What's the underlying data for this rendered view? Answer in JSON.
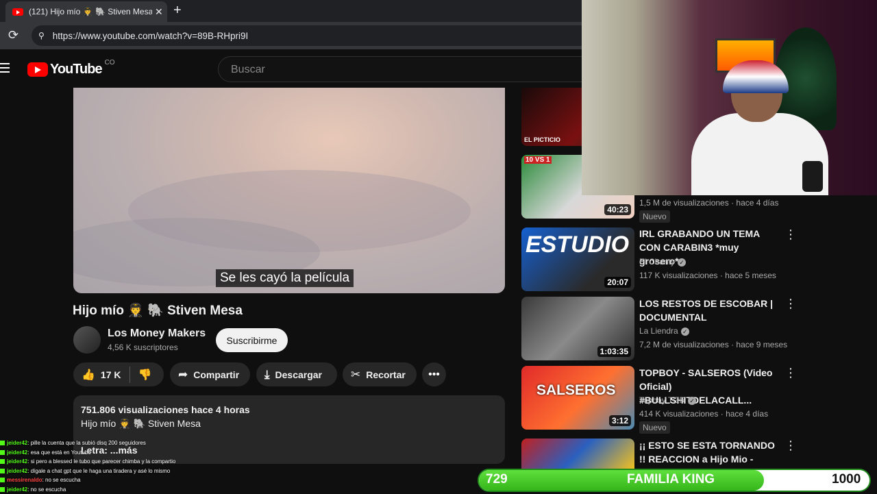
{
  "browser": {
    "tab_title": "(121) Hijo mío 🧑‍✈️ 🐘 Stiven Mesa",
    "tab_close": "✕",
    "new_tab": "+",
    "url": "https://www.youtube.com/watch?v=89B-RHpri9I"
  },
  "youtube": {
    "logo_text": "YouTube",
    "country": "CO",
    "search_placeholder": "Buscar"
  },
  "player": {
    "subtitle": "Se les cayó la película"
  },
  "video": {
    "title": "Hijo mío 🧑‍✈️ 🐘 Stiven Mesa",
    "channel": "Los Money Makers",
    "subscribers": "4,56 K suscriptores",
    "subscribe_label": "Suscribirme",
    "likes": "17 K",
    "share_label": "Compartir",
    "download_label": "Descargar",
    "clip_label": "Recortar",
    "views_time": "751.806 visualizaciones  hace 4 horas",
    "desc_title": "Hijo mío 🧑‍✈️ 🐘 Stiven Mesa",
    "desc_more": "Letra:  ...más"
  },
  "sidebar": {
    "items": [
      {
        "thumb_text": "EL PICTICIO",
        "duration": "",
        "title": "",
        "channel": "",
        "meta": "",
        "badge": ""
      },
      {
        "thumb_text": "10 VS 1",
        "duration": "40:23",
        "title": "",
        "channel": "",
        "meta": "1,5 M de visualizaciones · hace 4 días",
        "badge": "Nuevo"
      },
      {
        "thumb_text": "ESTUDIO",
        "duration": "20:07",
        "title": "IRL GRABANDO UN TEMA CON CARABIN3 *muy grosero*",
        "channel": "El Chanty",
        "meta": "117 K visualizaciones · hace 5 meses",
        "badge": ""
      },
      {
        "thumb_text": "",
        "duration": "1:03:35",
        "title": "LOS RESTOS DE ESCOBAR | DOCUMENTAL",
        "channel": "La Liendra",
        "meta": "7,2 M de visualizaciones · hace 9 meses",
        "badge": ""
      },
      {
        "thumb_text": "SALSEROS",
        "duration": "3:12",
        "title": "TOPBOY - SALSEROS (Video Oficial) #BULLSHITDELACALL...",
        "channel": "Topboy TGR",
        "meta": "414 K visualizaciones · hace 4 días",
        "badge": "Nuevo"
      },
      {
        "thumb_text": "",
        "duration": "",
        "title": "¡¡ ESTO SE ESTA TORNANDO !! REACCION a Hijo Mio - Stiven ...",
        "channel": "",
        "meta": "",
        "badge": ""
      }
    ]
  },
  "chat": [
    {
      "user": "jeider42",
      "msg": ": pille la cuenta que la subió disq 200 seguidores",
      "red": false
    },
    {
      "user": "jeider42",
      "msg": ": esa que está en Youtube",
      "red": false
    },
    {
      "user": "jeider42",
      "msg": ": si pero a blessed le tubo que parecer chimba y la compartio",
      "red": false
    },
    {
      "user": "jeider42",
      "msg": ": dígale a chat gpt que le haga una tiradera y asé lo mismo",
      "red": false
    },
    {
      "user": "messirenaldo",
      "msg": ": no se escucha",
      "red": true
    },
    {
      "user": "jeider42",
      "msg": ": no se escucha",
      "red": false
    }
  ],
  "goal": {
    "current": "729",
    "label": "FAMILIA KING",
    "target": "1000",
    "progress": 0.729
  },
  "colors": {
    "brand_red": "#ff0000",
    "goal_green": "#35b51a",
    "kick_green": "#53fc18"
  }
}
